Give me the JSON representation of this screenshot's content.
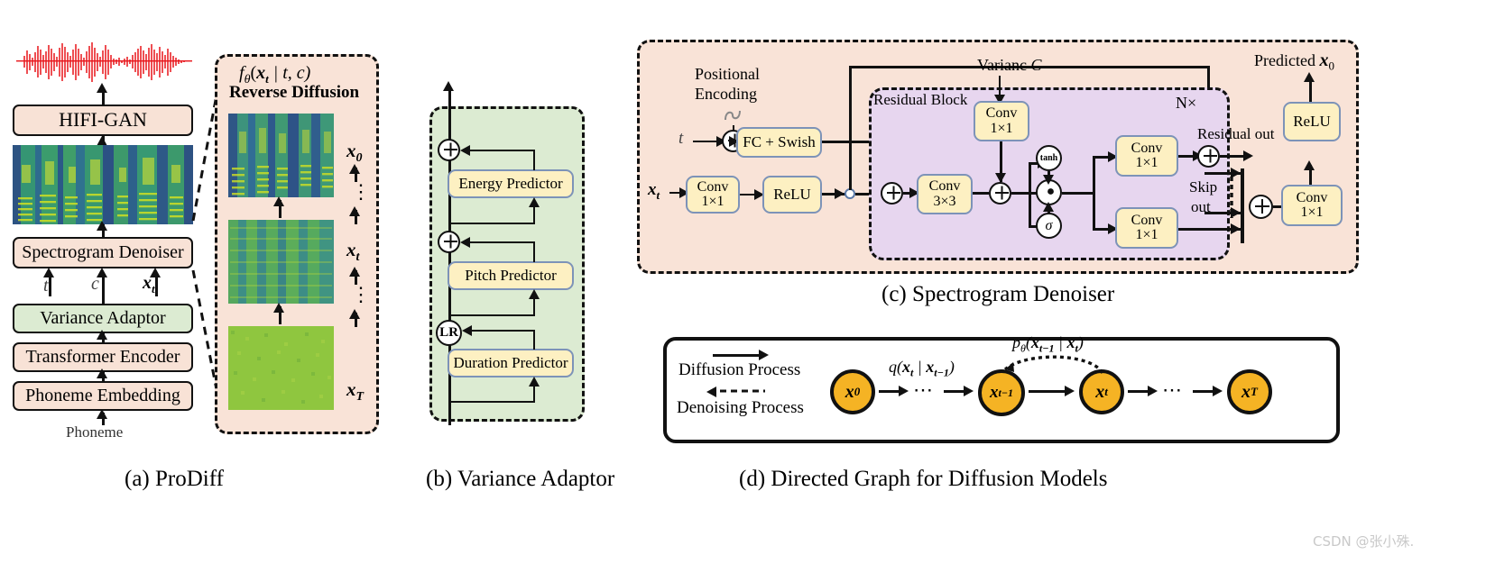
{
  "figure": {
    "watermark": "CSDN @张小殊."
  },
  "panel_a": {
    "caption": "(a) ProDiff",
    "waveform_label": "waveform",
    "blocks": [
      {
        "id": "hifigan",
        "label": "HIFI-GAN",
        "color": "#f8e2d6"
      },
      {
        "id": "spectrogram",
        "label": "spectrogram-image",
        "color": "#2a4a8c"
      },
      {
        "id": "denoiser",
        "label": "Spectrogram Denoiser",
        "color": "#f8e2d6"
      },
      {
        "id": "variance",
        "label": "Variance Adaptor",
        "color": "#dcebd2"
      },
      {
        "id": "encoder",
        "label": "Transformer Encoder",
        "color": "#f8e2d6"
      },
      {
        "id": "embedding",
        "label": "Phoneme Embedding",
        "color": "#f8e2d6"
      }
    ],
    "input_label": "Phoneme",
    "signal_labels": [
      "t",
      "c",
      "x",
      "t"
    ],
    "signal_t": "t",
    "signal_c": "c",
    "signal_xt": "x",
    "signal_xt_sub": "t"
  },
  "panel_reverse": {
    "formula": "f",
    "formula_sub": "θ",
    "formula_rest": "(x",
    "formula_args": " | t, c)",
    "title": "Reverse Diffusion",
    "steps": [
      {
        "label": "x",
        "sub": "0"
      },
      {
        "label": "x",
        "sub": "t"
      },
      {
        "label": "x",
        "sub": "T"
      }
    ],
    "ellipsis": "⋮"
  },
  "panel_b": {
    "caption": "(b) Variance Adaptor",
    "predictors": [
      {
        "id": "energy",
        "label": "Energy Predictor"
      },
      {
        "id": "pitch",
        "label": "Pitch Predictor"
      },
      {
        "id": "duration",
        "label": "Duration Predictor"
      }
    ],
    "operators": [
      {
        "id": "add-energy",
        "symbol": "⊕"
      },
      {
        "id": "add-pitch",
        "symbol": "⊕"
      },
      {
        "id": "length-regulator",
        "symbol": "LR"
      }
    ]
  },
  "panel_c": {
    "caption": "(c) Spectrogram Denoiser",
    "positional_encoding": "Positional\nEncoding",
    "positional_encoding_line1": "Positional",
    "positional_encoding_line2": "Encoding",
    "input_t": "t",
    "input_xt": "x",
    "input_xt_sub": "t",
    "variance_label": "Varianc",
    "variance_symbol": "C",
    "residual_block_label": "Residual Block",
    "repeat_label": "N×",
    "residual_out_label": "Residual out",
    "skip_out_line1": "Skip",
    "skip_out_line2": "out",
    "predicted_label": "Predicted",
    "predicted_symbol": "x",
    "predicted_sub": "0",
    "blocks": [
      {
        "id": "fc-swish",
        "line1": "FC + Swish",
        "line2": ""
      },
      {
        "id": "conv-in",
        "line1": "Conv",
        "line2": "1×1"
      },
      {
        "id": "relu-in",
        "line1": "ReLU",
        "line2": ""
      },
      {
        "id": "conv-variance",
        "line1": "Conv",
        "line2": "1×1"
      },
      {
        "id": "conv-dilated",
        "line1": "Conv",
        "line2": "3×3"
      },
      {
        "id": "conv-residual",
        "line1": "Conv",
        "line2": "1×1"
      },
      {
        "id": "conv-skip",
        "line1": "Conv",
        "line2": "1×1"
      },
      {
        "id": "conv-out",
        "line1": "Conv",
        "line2": "1×1"
      },
      {
        "id": "relu-out",
        "line1": "ReLU",
        "line2": ""
      }
    ],
    "gates": [
      {
        "id": "tanh-gate",
        "label": "tanh"
      },
      {
        "id": "sigmoid-gate",
        "label": "σ"
      },
      {
        "id": "elementwise-mul",
        "label": "⊙"
      }
    ],
    "colors": {
      "panel_bg": "#f9e3d7",
      "residual_bg": "#e7d6ef",
      "block_bg": "#fdf0c2",
      "block_border": "#7d93b8"
    }
  },
  "panel_d": {
    "caption": "(d) Directed Graph for Diffusion Models",
    "legend": [
      {
        "id": "diffusion",
        "label": "Diffusion Process",
        "style": "solid"
      },
      {
        "id": "denoising",
        "label": "Denoising Process",
        "style": "dashed"
      }
    ],
    "forward_formula_q": "q(x",
    "forward_formula": "q(x_t | x_{t-1})",
    "reverse_formula": "p_θ(x_{t-1} | x_t)",
    "nodes": [
      {
        "id": "x0",
        "label": "x",
        "sub": "0"
      },
      {
        "id": "xt-1",
        "label": "x",
        "sub": "t−1"
      },
      {
        "id": "xt",
        "label": "x",
        "sub": "t"
      },
      {
        "id": "xT",
        "label": "x",
        "sub": "T"
      }
    ],
    "ellipsis": "⋯"
  }
}
